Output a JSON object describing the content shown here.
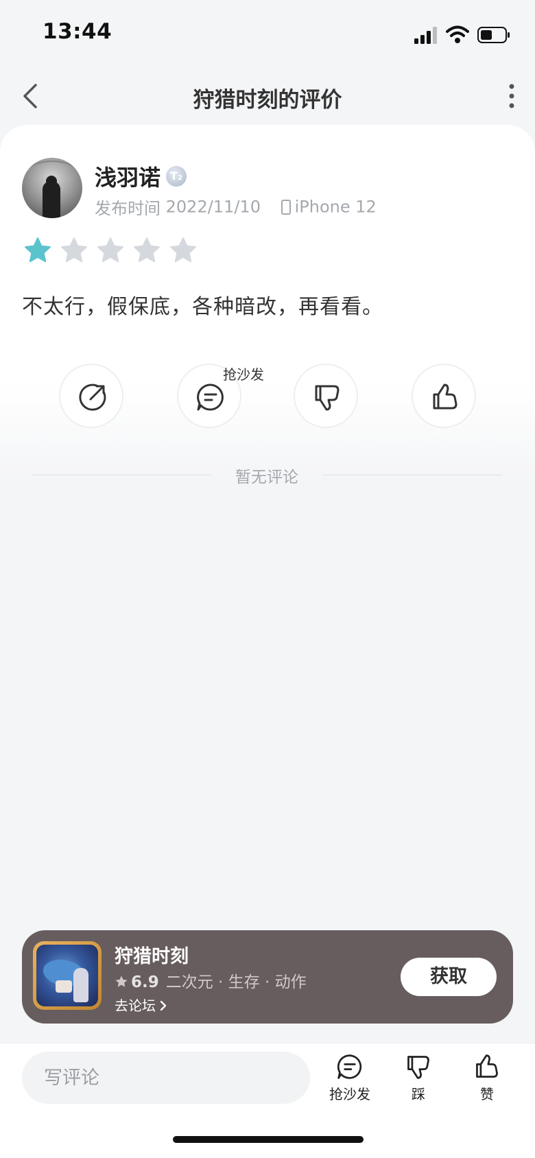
{
  "status_bar": {
    "time": "13:44"
  },
  "nav": {
    "title": "狩猎时刻的评价"
  },
  "review": {
    "username": "浅羽诺",
    "level_badge": "T",
    "level_sub": "2",
    "publish_label": "发布时间",
    "publish_date": "2022/11/10",
    "device": "iPhone 12",
    "rating": 1,
    "rating_max": 5,
    "content": "不太行，假保底，各种暗改，再看看。",
    "sofa_label": "抢沙发",
    "no_comment": "暂无评论"
  },
  "game": {
    "name": "狩猎时刻",
    "score": "6.9",
    "tags": "二次元 · 生存 · 动作",
    "forum_link": "去论坛",
    "get_label": "获取"
  },
  "bottom_bar": {
    "input_placeholder": "写评论",
    "sofa": "抢沙发",
    "dislike": "踩",
    "like": "赞"
  },
  "colors": {
    "star_active": "#5bc3cc",
    "star_inactive": "#d5d9de",
    "banner_bg": "#675d5e"
  }
}
